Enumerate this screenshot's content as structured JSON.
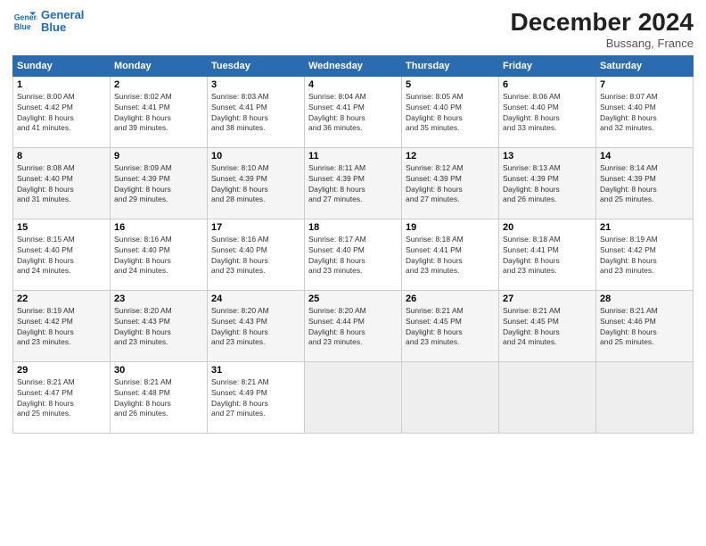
{
  "header": {
    "logo_line1": "General",
    "logo_line2": "Blue",
    "month_title": "December 2024",
    "location": "Bussang, France"
  },
  "weekdays": [
    "Sunday",
    "Monday",
    "Tuesday",
    "Wednesday",
    "Thursday",
    "Friday",
    "Saturday"
  ],
  "weeks": [
    [
      {
        "day": "1",
        "sunrise": "8:00 AM",
        "sunset": "4:42 PM",
        "daylight": "8 hours and 41 minutes."
      },
      {
        "day": "2",
        "sunrise": "8:02 AM",
        "sunset": "4:41 PM",
        "daylight": "8 hours and 39 minutes."
      },
      {
        "day": "3",
        "sunrise": "8:03 AM",
        "sunset": "4:41 PM",
        "daylight": "8 hours and 38 minutes."
      },
      {
        "day": "4",
        "sunrise": "8:04 AM",
        "sunset": "4:41 PM",
        "daylight": "8 hours and 36 minutes."
      },
      {
        "day": "5",
        "sunrise": "8:05 AM",
        "sunset": "4:40 PM",
        "daylight": "8 hours and 35 minutes."
      },
      {
        "day": "6",
        "sunrise": "8:06 AM",
        "sunset": "4:40 PM",
        "daylight": "8 hours and 33 minutes."
      },
      {
        "day": "7",
        "sunrise": "8:07 AM",
        "sunset": "4:40 PM",
        "daylight": "8 hours and 32 minutes."
      }
    ],
    [
      {
        "day": "8",
        "sunrise": "8:08 AM",
        "sunset": "4:40 PM",
        "daylight": "8 hours and 31 minutes."
      },
      {
        "day": "9",
        "sunrise": "8:09 AM",
        "sunset": "4:39 PM",
        "daylight": "8 hours and 29 minutes."
      },
      {
        "day": "10",
        "sunrise": "8:10 AM",
        "sunset": "4:39 PM",
        "daylight": "8 hours and 28 minutes."
      },
      {
        "day": "11",
        "sunrise": "8:11 AM",
        "sunset": "4:39 PM",
        "daylight": "8 hours and 27 minutes."
      },
      {
        "day": "12",
        "sunrise": "8:12 AM",
        "sunset": "4:39 PM",
        "daylight": "8 hours and 27 minutes."
      },
      {
        "day": "13",
        "sunrise": "8:13 AM",
        "sunset": "4:39 PM",
        "daylight": "8 hours and 26 minutes."
      },
      {
        "day": "14",
        "sunrise": "8:14 AM",
        "sunset": "4:39 PM",
        "daylight": "8 hours and 25 minutes."
      }
    ],
    [
      {
        "day": "15",
        "sunrise": "8:15 AM",
        "sunset": "4:40 PM",
        "daylight": "8 hours and 24 minutes."
      },
      {
        "day": "16",
        "sunrise": "8:16 AM",
        "sunset": "4:40 PM",
        "daylight": "8 hours and 24 minutes."
      },
      {
        "day": "17",
        "sunrise": "8:16 AM",
        "sunset": "4:40 PM",
        "daylight": "8 hours and 23 minutes."
      },
      {
        "day": "18",
        "sunrise": "8:17 AM",
        "sunset": "4:40 PM",
        "daylight": "8 hours and 23 minutes."
      },
      {
        "day": "19",
        "sunrise": "8:18 AM",
        "sunset": "4:41 PM",
        "daylight": "8 hours and 23 minutes."
      },
      {
        "day": "20",
        "sunrise": "8:18 AM",
        "sunset": "4:41 PM",
        "daylight": "8 hours and 23 minutes."
      },
      {
        "day": "21",
        "sunrise": "8:19 AM",
        "sunset": "4:42 PM",
        "daylight": "8 hours and 23 minutes."
      }
    ],
    [
      {
        "day": "22",
        "sunrise": "8:19 AM",
        "sunset": "4:42 PM",
        "daylight": "8 hours and 23 minutes."
      },
      {
        "day": "23",
        "sunrise": "8:20 AM",
        "sunset": "4:43 PM",
        "daylight": "8 hours and 23 minutes."
      },
      {
        "day": "24",
        "sunrise": "8:20 AM",
        "sunset": "4:43 PM",
        "daylight": "8 hours and 23 minutes."
      },
      {
        "day": "25",
        "sunrise": "8:20 AM",
        "sunset": "4:44 PM",
        "daylight": "8 hours and 23 minutes."
      },
      {
        "day": "26",
        "sunrise": "8:21 AM",
        "sunset": "4:45 PM",
        "daylight": "8 hours and 23 minutes."
      },
      {
        "day": "27",
        "sunrise": "8:21 AM",
        "sunset": "4:45 PM",
        "daylight": "8 hours and 24 minutes."
      },
      {
        "day": "28",
        "sunrise": "8:21 AM",
        "sunset": "4:46 PM",
        "daylight": "8 hours and 25 minutes."
      }
    ],
    [
      {
        "day": "29",
        "sunrise": "8:21 AM",
        "sunset": "4:47 PM",
        "daylight": "8 hours and 25 minutes."
      },
      {
        "day": "30",
        "sunrise": "8:21 AM",
        "sunset": "4:48 PM",
        "daylight": "8 hours and 26 minutes."
      },
      {
        "day": "31",
        "sunrise": "8:21 AM",
        "sunset": "4:49 PM",
        "daylight": "8 hours and 27 minutes."
      },
      null,
      null,
      null,
      null
    ]
  ],
  "labels": {
    "sunrise": "Sunrise:",
    "sunset": "Sunset:",
    "daylight": "Daylight:"
  }
}
